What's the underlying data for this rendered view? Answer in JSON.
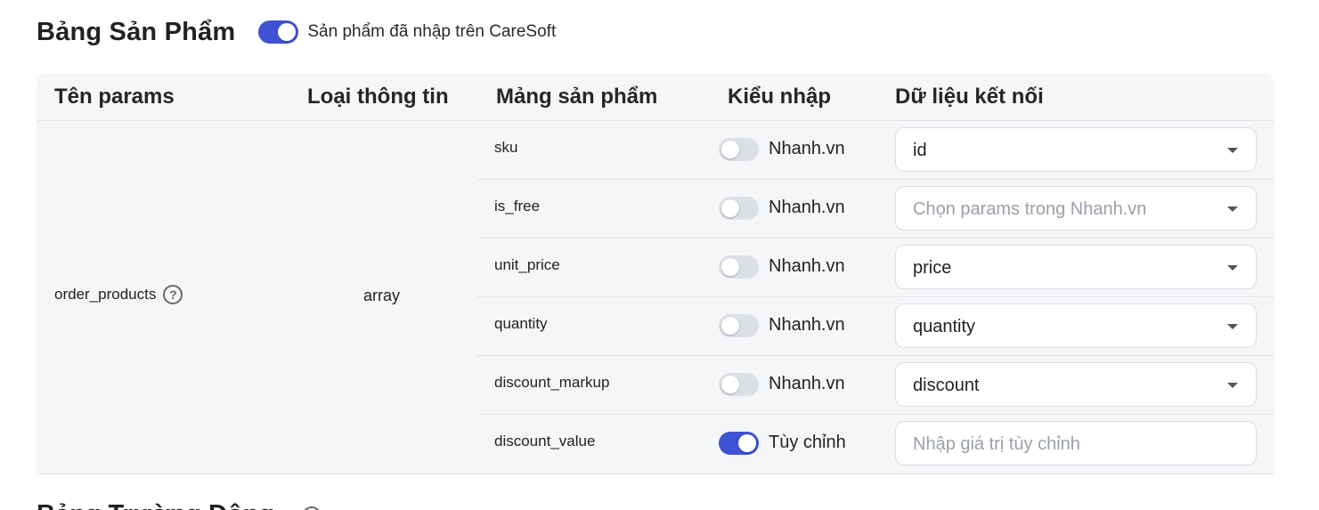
{
  "header": {
    "title": "Bảng Sản Phẩm",
    "toggle_label": "Sản phẩm đã nhập trên CareSoft",
    "toggle_on": true
  },
  "table": {
    "columns": [
      "Tên params",
      "Loại thông tin",
      "Mảng sản phẩm",
      "Kiểu nhập",
      "Dữ liệu kết nối"
    ],
    "param_name": "order_products",
    "param_type": "array",
    "rows": [
      {
        "field": "sku",
        "toggle_on": false,
        "mode": "Nhanh.vn",
        "value": "id",
        "placeholder": "",
        "kind": "select"
      },
      {
        "field": "is_free",
        "toggle_on": false,
        "mode": "Nhanh.vn",
        "value": "",
        "placeholder": "Chọn params trong Nhanh.vn",
        "kind": "select"
      },
      {
        "field": "unit_price",
        "toggle_on": false,
        "mode": "Nhanh.vn",
        "value": "price",
        "placeholder": "",
        "kind": "select"
      },
      {
        "field": "quantity",
        "toggle_on": false,
        "mode": "Nhanh.vn",
        "value": "quantity",
        "placeholder": "",
        "kind": "select"
      },
      {
        "field": "discount_markup",
        "toggle_on": false,
        "mode": "Nhanh.vn",
        "value": "discount",
        "placeholder": "",
        "kind": "select"
      },
      {
        "field": "discount_value",
        "toggle_on": true,
        "mode": "Tùy chỉnh",
        "value": "",
        "placeholder": "Nhập giá trị tùy chỉnh",
        "kind": "input"
      }
    ]
  },
  "next_section": {
    "title": "Bảng Trường Động"
  },
  "colors": {
    "accent": "#3f51d4",
    "toggle_off": "#dcdfe6",
    "table_bg": "#f5f6f8"
  }
}
